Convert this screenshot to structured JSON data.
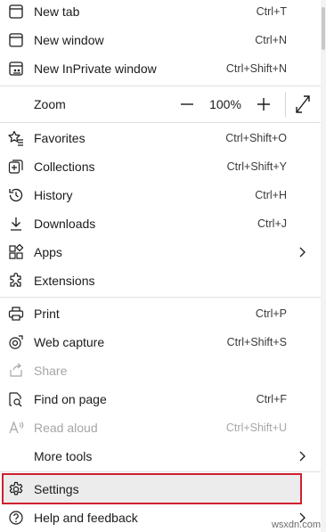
{
  "menu": {
    "new_tab": {
      "label": "New tab",
      "shortcut": "Ctrl+T"
    },
    "new_window": {
      "label": "New window",
      "shortcut": "Ctrl+N"
    },
    "new_inprivate": {
      "label": "New InPrivate window",
      "shortcut": "Ctrl+Shift+N"
    },
    "zoom": {
      "label": "Zoom",
      "value": "100%",
      "minus": "—",
      "plus": "+"
    },
    "favorites": {
      "label": "Favorites",
      "shortcut": "Ctrl+Shift+O"
    },
    "collections": {
      "label": "Collections",
      "shortcut": "Ctrl+Shift+Y"
    },
    "history": {
      "label": "History",
      "shortcut": "Ctrl+H"
    },
    "downloads": {
      "label": "Downloads",
      "shortcut": "Ctrl+J"
    },
    "apps": {
      "label": "Apps"
    },
    "extensions": {
      "label": "Extensions"
    },
    "print": {
      "label": "Print",
      "shortcut": "Ctrl+P"
    },
    "web_capture": {
      "label": "Web capture",
      "shortcut": "Ctrl+Shift+S"
    },
    "share": {
      "label": "Share"
    },
    "find": {
      "label": "Find on page",
      "shortcut": "Ctrl+F"
    },
    "read_aloud": {
      "label": "Read aloud",
      "shortcut": "Ctrl+Shift+U"
    },
    "more_tools": {
      "label": "More tools"
    },
    "settings": {
      "label": "Settings"
    },
    "help": {
      "label": "Help and feedback"
    }
  },
  "highlight_color": "#d0202f",
  "watermark": "wsxdn.com"
}
